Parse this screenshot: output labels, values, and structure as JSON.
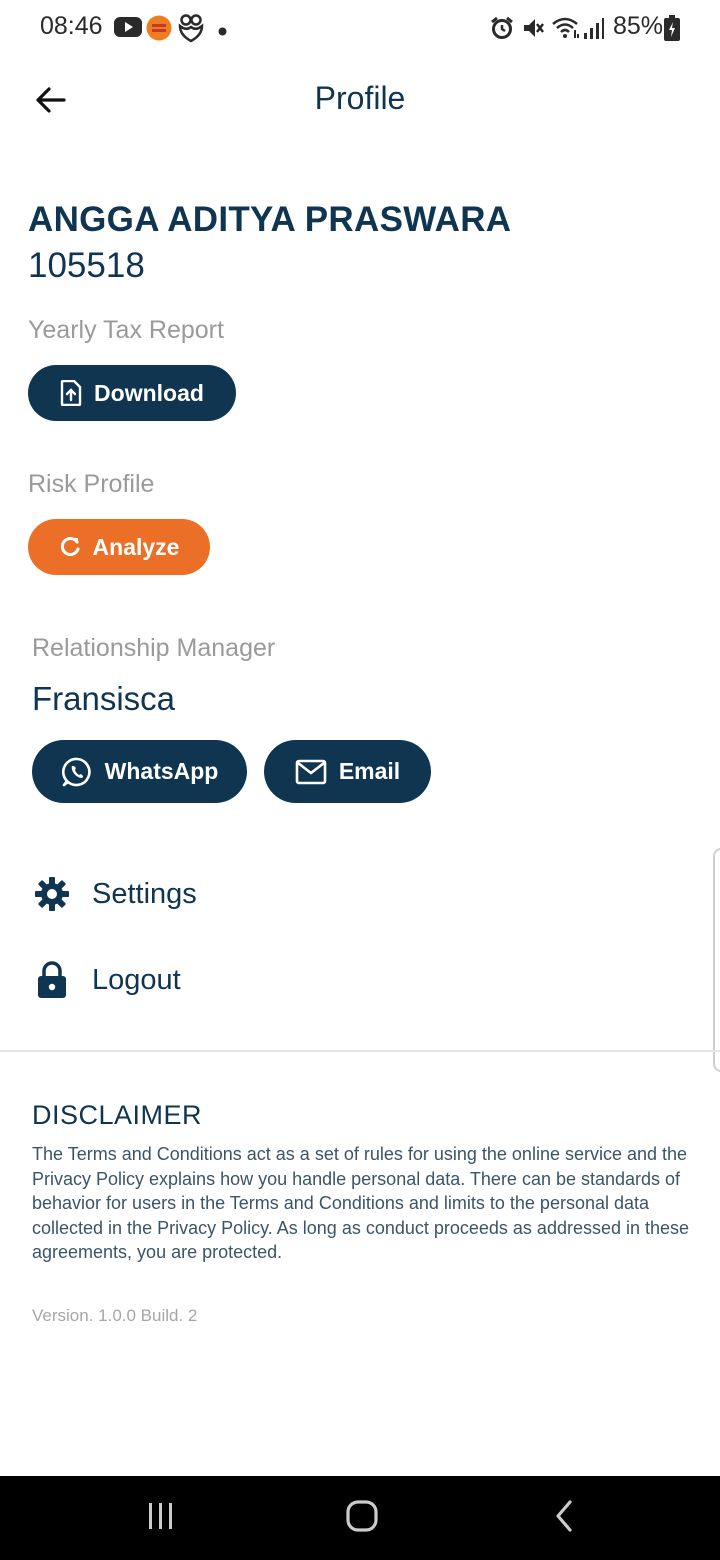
{
  "status_bar": {
    "time": "08:46",
    "battery": "85%",
    "icons": [
      "youtube-icon",
      "club-app-icon",
      "heart-app-icon",
      "notification-dot",
      "alarm-icon",
      "mute-icon",
      "wifi-icon",
      "signal-icon",
      "battery-icon"
    ]
  },
  "header": {
    "title": "Profile",
    "back_icon": "arrow-left-icon"
  },
  "user": {
    "name": "ANGGA ADITYA PRASWARA",
    "id": "105518"
  },
  "tax_report": {
    "label": "Yearly Tax Report",
    "button_label": "Download",
    "icon": "file-upload-icon"
  },
  "risk_profile": {
    "label": "Risk Profile",
    "button_label": "Analyze",
    "icon": "refresh-icon"
  },
  "relationship_manager": {
    "label": "Relationship Manager",
    "name": "Fransisca",
    "whatsapp_label": "WhatsApp",
    "email_label": "Email"
  },
  "menu": {
    "items": [
      {
        "label": "Settings",
        "icon": "gear-icon"
      },
      {
        "label": "Logout",
        "icon": "lock-icon"
      }
    ]
  },
  "disclaimer": {
    "title": "DISCLAIMER",
    "text": "The Terms and Conditions act as a set of rules for using the online service and the Privacy Policy explains how you handle personal data. There can be standards of behavior for users in the Terms and Conditions and limits to the personal data collected in the Privacy Policy. As long as conduct proceeds as addressed in these agreements, you are protected."
  },
  "version": "Version. 1.0.0 Build. 2",
  "colors": {
    "primary": "#0f3550",
    "accent": "#ec6f28",
    "label_gray": "#9a9a9a"
  },
  "nav_bar": {
    "icons": [
      "recent-apps-icon",
      "home-icon",
      "back-nav-icon"
    ]
  }
}
